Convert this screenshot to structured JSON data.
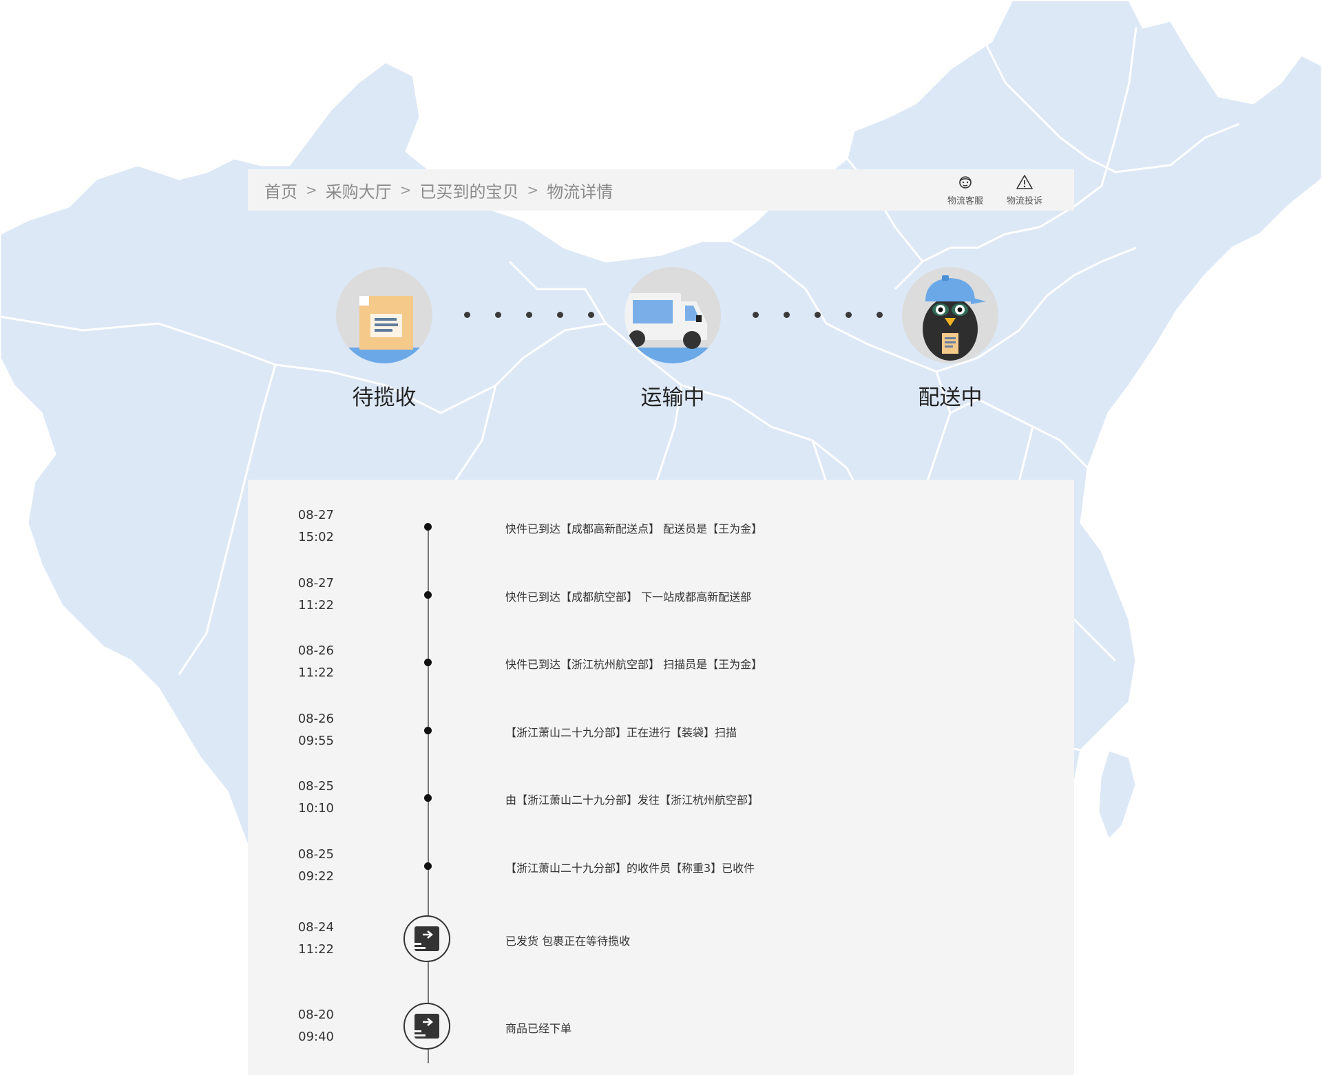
{
  "breadcrumb": {
    "items": [
      {
        "label": "首页"
      },
      {
        "label": "采购大厅"
      },
      {
        "label": "已买到的宝贝"
      },
      {
        "label": "物流详情"
      }
    ],
    "separator": ">"
  },
  "actions": {
    "service_label": "物流客服",
    "complaint_label": "物流投诉"
  },
  "steps": [
    {
      "label": "待揽收",
      "icon": "package-icon"
    },
    {
      "label": "运输中",
      "icon": "truck-icon"
    },
    {
      "label": "配送中",
      "icon": "courier-penguin-icon"
    }
  ],
  "timeline": [
    {
      "date": "08-27",
      "time": "15:02",
      "text": "快件已到达【成都高新配送点】 配送员是【王为金】"
    },
    {
      "date": "08-27",
      "time": "11:22",
      "text": "快件已到达【成都航空部】 下一站成都高新配送部"
    },
    {
      "date": "08-26",
      "time": "11:22",
      "text": "快件已到达【浙江杭州航空部】 扫描员是【王为金】"
    },
    {
      "date": "08-26",
      "time": "09:55",
      "text": "【浙江萧山二十九分部】正在进行【装袋】扫描"
    },
    {
      "date": "08-25",
      "time": "10:10",
      "text": "由【浙江萧山二十九分部】发往【浙江杭州航空部】"
    },
    {
      "date": "08-25",
      "time": "09:22",
      "text": "【浙江萧山二十九分部】的收件员【称重3】已收件"
    },
    {
      "date": "08-24",
      "time": "11:22",
      "text": "已发货 包裹正在等待揽收"
    },
    {
      "date": "08-20",
      "time": "09:40",
      "text": "商品已经下单"
    }
  ],
  "colors": {
    "map_fill": "#dce8f6",
    "map_border": "#ffffff",
    "panel_bg": "#f4f4f4",
    "accent_blue": "#6aa8e8",
    "package_orange": "#f4c98a"
  }
}
